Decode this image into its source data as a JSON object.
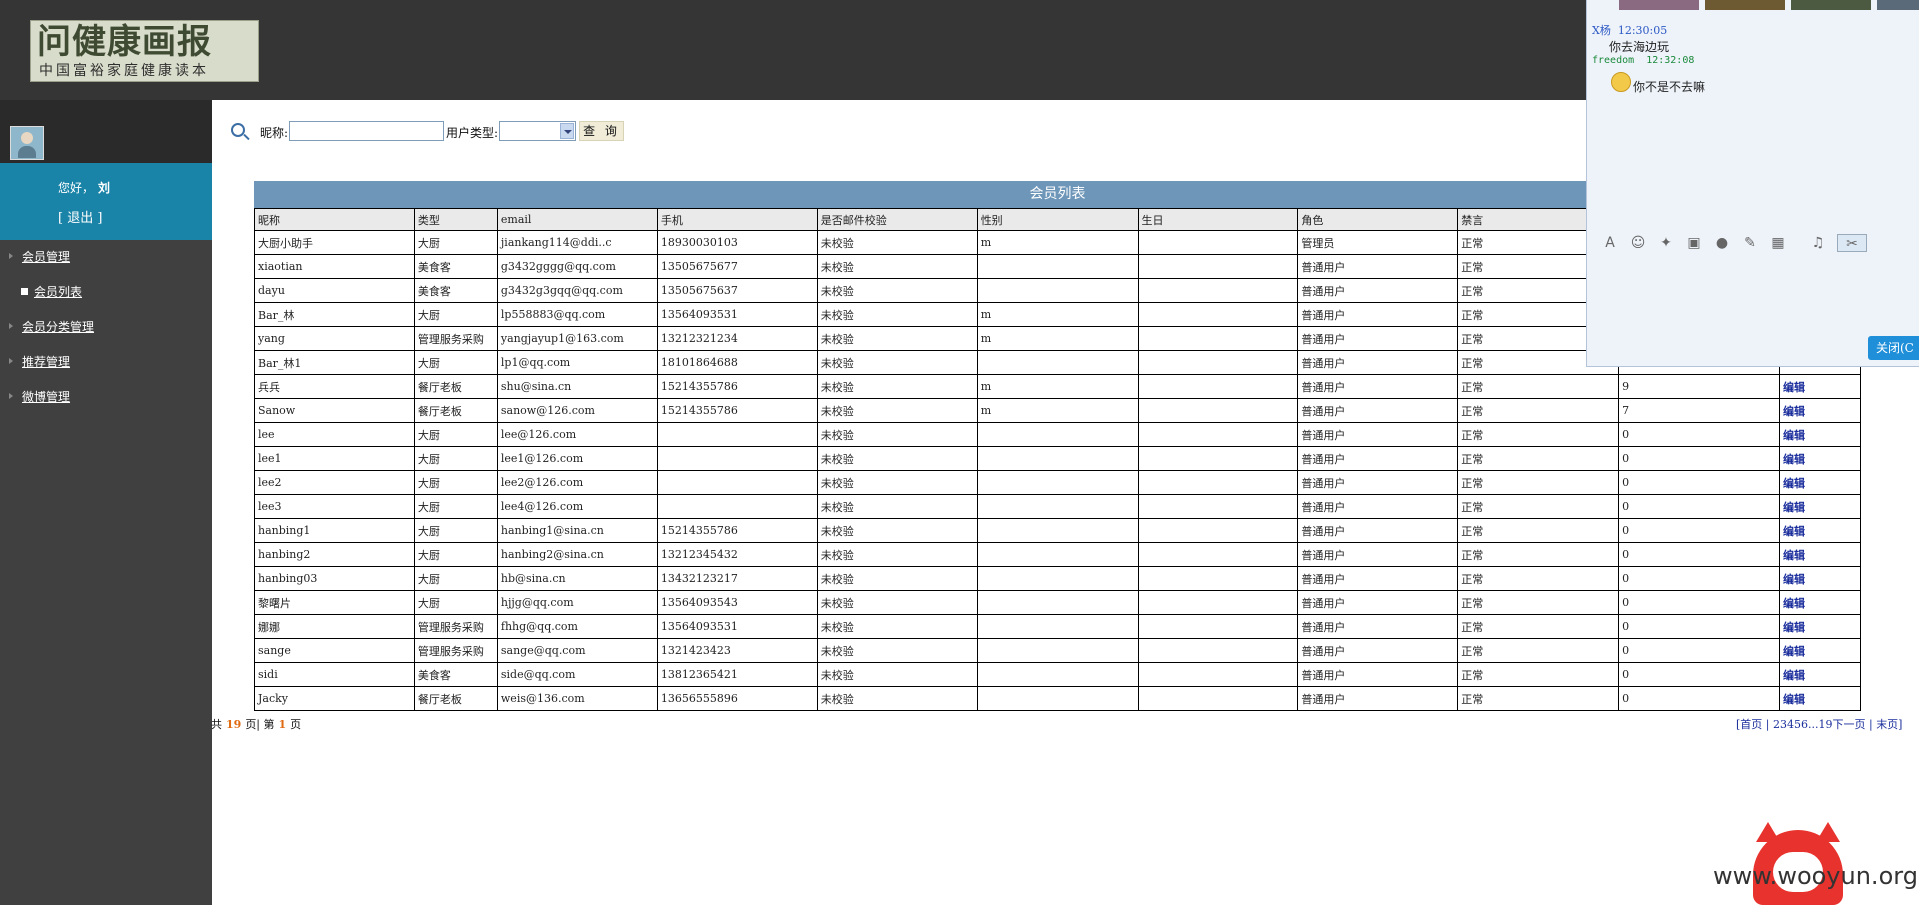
{
  "header": {
    "logo_title": "问健康画报",
    "logo_subtitle": "中国富裕家庭健康读本"
  },
  "sidebar": {
    "greeting": "您好，",
    "username": "刘",
    "logout": "[ 退出 ]",
    "nav": [
      {
        "label": "会员管理"
      },
      {
        "label": "会员列表"
      },
      {
        "label": "会员分类管理"
      },
      {
        "label": "推荐管理"
      },
      {
        "label": "微博管理"
      }
    ]
  },
  "search": {
    "nickname_label": "昵称:",
    "nickname_value": "",
    "usertype_label": "用户类型:",
    "usertype_value": "",
    "query_button": "查 询"
  },
  "table": {
    "title": "会员列表",
    "columns": [
      "昵称",
      "类型",
      "email",
      "手机",
      "是否邮件校验",
      "性别",
      "生日",
      "角色",
      "禁言",
      "",
      ""
    ],
    "rows": [
      [
        "大厨小助手",
        "大厨",
        "jiankang114@ddi..c",
        "18930030103",
        "未校验",
        "m",
        "",
        "管理员",
        "正常",
        "",
        ""
      ],
      [
        "xiaotian",
        "美食客",
        "g3432gggg@qq.com",
        "13505675677",
        "未校验",
        "",
        "",
        "普通用户",
        "正常",
        "",
        ""
      ],
      [
        "dayu",
        "美食客",
        "g3432g3gqq@qq.com",
        "13505675637",
        "未校验",
        "",
        "",
        "普通用户",
        "正常",
        "",
        ""
      ],
      [
        "Bar_林",
        "大厨",
        "lp558883@qq.com",
        "13564093531",
        "未校验",
        "m",
        "",
        "普通用户",
        "正常",
        "",
        ""
      ],
      [
        "yang",
        "管理服务采购",
        "yangjayup1@163.com",
        "13212321234",
        "未校验",
        "m",
        "",
        "普通用户",
        "正常",
        "",
        ""
      ],
      [
        "Bar_林1",
        "大厨",
        "lp1@qq.com",
        "18101864688",
        "未校验",
        "",
        "",
        "普通用户",
        "正常",
        "",
        ""
      ],
      [
        "兵兵",
        "餐厅老板",
        "shu@sina.cn",
        "15214355786",
        "未校验",
        "m",
        "",
        "普通用户",
        "正常",
        "9",
        "编辑"
      ],
      [
        "Sanow",
        "餐厅老板",
        "sanow@126.com",
        "15214355786",
        "未校验",
        "m",
        "",
        "普通用户",
        "正常",
        "7",
        "编辑"
      ],
      [
        "lee",
        "大厨",
        "lee@126.com",
        "",
        "未校验",
        "",
        "",
        "普通用户",
        "正常",
        "0",
        "编辑"
      ],
      [
        "lee1",
        "大厨",
        "lee1@126.com",
        "",
        "未校验",
        "",
        "",
        "普通用户",
        "正常",
        "0",
        "编辑"
      ],
      [
        "lee2",
        "大厨",
        "lee2@126.com",
        "",
        "未校验",
        "",
        "",
        "普通用户",
        "正常",
        "0",
        "编辑"
      ],
      [
        "lee3",
        "大厨",
        "lee4@126.com",
        "",
        "未校验",
        "",
        "",
        "普通用户",
        "正常",
        "0",
        "编辑"
      ],
      [
        "hanbing1",
        "大厨",
        "hanbing1@sina.cn",
        "15214355786",
        "未校验",
        "",
        "",
        "普通用户",
        "正常",
        "0",
        "编辑"
      ],
      [
        "hanbing2",
        "大厨",
        "hanbing2@sina.cn",
        "13212345432",
        "未校验",
        "",
        "",
        "普通用户",
        "正常",
        "0",
        "编辑"
      ],
      [
        "hanbing03",
        "大厨",
        "hb@sina.cn",
        "13432123217",
        "未校验",
        "",
        "",
        "普通用户",
        "正常",
        "0",
        "编辑"
      ],
      [
        "黎曙片",
        "大厨",
        "hjjg@qq.com",
        "13564093543",
        "未校验",
        "",
        "",
        "普通用户",
        "正常",
        "0",
        "编辑"
      ],
      [
        "娜娜",
        "管理服务采购",
        "fhhg@qq.com",
        "13564093531",
        "未校验",
        "",
        "",
        "普通用户",
        "正常",
        "0",
        "编辑"
      ],
      [
        "sange",
        "管理服务采购",
        "sange@qq.com",
        "1321423423",
        "未校验",
        "",
        "",
        "普通用户",
        "正常",
        "0",
        "编辑"
      ],
      [
        "sidi",
        "美食客",
        "side@qq.com",
        "13812365421",
        "未校验",
        "",
        "",
        "普通用户",
        "正常",
        "0",
        "编辑"
      ],
      [
        "Jacky",
        "餐厅老板",
        "weis@136.com",
        "13656555896",
        "未校验",
        "",
        "",
        "普通用户",
        "正常",
        "0",
        "编辑"
      ]
    ]
  },
  "pager": {
    "total_prefix": "共",
    "total_pages": "19",
    "total_suffix": "页| 第",
    "current_page": "1",
    "current_suffix": "页",
    "first": "[首页",
    "pages": "23456...19",
    "next": "下一页",
    "last": "末页]"
  },
  "chat": {
    "messages": [
      {
        "name": "X杨",
        "time": "12:30:05",
        "text": "你去海边玩"
      },
      {
        "name": "freedom",
        "time": "12:32:08",
        "text": "你不是不去嘛"
      }
    ],
    "close_button": "关闭(C"
  },
  "watermark": "www.wooyun.org",
  "colors": {
    "header_bg": "#353535",
    "sidebar_bg": "#404040",
    "welcome_bg": "#1a84a8",
    "table_title_bg": "#6d96b8",
    "pager_highlight": "#e06a12",
    "link": "#1b2e9c"
  }
}
